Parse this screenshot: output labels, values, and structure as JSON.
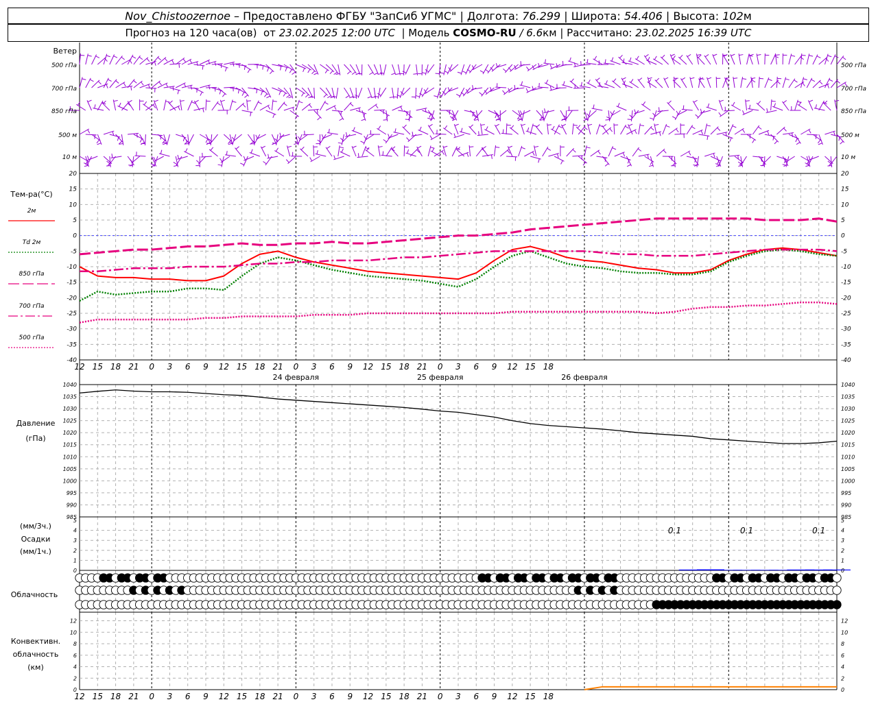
{
  "header": {
    "station": "Nov_Chistoozernoe",
    "provider": " – Предоставлено ФГБУ \"ЗапСиб УГМС\" | Долгота: ",
    "lon": "76.299",
    "lat_label": " | Широта: ",
    "lat": "54.406",
    "alt_label": " | Высота: ",
    "alt": "102",
    "alt_unit": "м",
    "forecast_label": "Прогноз на 120 часа(ов)  от ",
    "forecast_time": "23.02.2025 12:00 UTC",
    "model_label": "  | Модель ",
    "model": "COSMO-RU",
    "res": " / 6.6",
    "res_unit": "км",
    "calc_label": " | Рассчитано: ",
    "calc_time": "23.02.2025 16:39 UTC"
  },
  "wind": {
    "title": "Ветер",
    "levels": [
      "500 гПа",
      "700 гПа",
      "850 гПа",
      "500 м",
      "10 м"
    ]
  },
  "temp": {
    "title": "Тем-ра(°C)",
    "ticks": [
      20,
      15,
      10,
      5,
      0,
      -5,
      -10,
      -15,
      -20,
      -25,
      -30,
      -35,
      -40
    ],
    "legend": [
      {
        "label": "2м",
        "color": "#ff0000",
        "dash": "solid"
      },
      {
        "label": "Td  2м",
        "color": "#008000",
        "dash": "dot"
      },
      {
        "label": "850 гПа",
        "color": "#e6007e",
        "dash": "long"
      },
      {
        "label": "700 гПа",
        "color": "#e6007e",
        "dash": "dashdot"
      },
      {
        "label": "500 гПа",
        "color": "#e6007e",
        "dash": "dot"
      }
    ]
  },
  "time": {
    "hour_labels": [
      "12",
      "15",
      "18",
      "21",
      "0",
      "3",
      "6",
      "9",
      "12",
      "15",
      "18",
      "21",
      "0",
      "3",
      "6",
      "9",
      "12",
      "15",
      "18",
      "21",
      "0",
      "3",
      "6",
      "9",
      "12",
      "15",
      "18"
    ],
    "dates": [
      "24 февраля",
      "25 февраля",
      "26 февраля"
    ]
  },
  "pressure": {
    "title1": "Давление",
    "title2": "(гПа)",
    "ticks": [
      1040,
      1035,
      1030,
      1025,
      1020,
      1015,
      1010,
      1005,
      1000,
      995,
      990,
      985
    ]
  },
  "precip": {
    "title1": "(мм/3ч.)",
    "title2": "Осадки",
    "title3": "(мм/1ч.)",
    "ticks": [
      5,
      4,
      3,
      2,
      1,
      0
    ],
    "labels": [
      "0.1",
      "0.1",
      "0.1",
      "0.1",
      "0.1",
      "0.1"
    ]
  },
  "cloud": {
    "title": "Облачность"
  },
  "conv": {
    "title1": "Конвективн.",
    "title2": "облачность",
    "title3": "(км)",
    "ticks": [
      12,
      10,
      8,
      6,
      4,
      2,
      0
    ]
  },
  "chart_data": [
    {
      "type": "line",
      "title": "Тем-ра(°C)",
      "x": [
        0,
        3,
        6,
        9,
        12,
        15,
        18,
        21,
        24,
        27,
        30,
        33,
        36,
        39,
        42,
        45,
        48,
        51,
        54,
        57,
        60,
        63,
        66,
        69,
        72,
        75,
        78,
        81,
        84,
        87,
        90,
        93,
        96,
        99,
        102,
        105,
        108,
        111,
        114,
        117,
        120,
        123,
        126
      ],
      "ylim": [
        -40,
        20
      ],
      "series": [
        {
          "name": "2м",
          "color": "#ff0000",
          "values": [
            -10,
            -13,
            -13.5,
            -13.5,
            -14,
            -14,
            -14.5,
            -14.5,
            -13,
            -9,
            -6,
            -5,
            -7,
            -8.5,
            -9.5,
            -10.5,
            -11.5,
            -12,
            -12.5,
            -13,
            -13.5,
            -14,
            -12,
            -8,
            -4.5,
            -3.5,
            -5,
            -7,
            -8,
            -8.5,
            -9.5,
            -10.5,
            -11,
            -12,
            -12,
            -11,
            -8,
            -6,
            -4.5,
            -4,
            -4.5,
            -5.5,
            -6.5
          ]
        },
        {
          "name": "Td  2м",
          "color": "#008000",
          "values": [
            -21,
            -18,
            -19,
            -18.5,
            -18,
            -18,
            -17,
            -17,
            -17.5,
            -13,
            -9,
            -7,
            -8,
            -9.5,
            -11,
            -12,
            -13,
            -13.5,
            -14,
            -14.5,
            -15.5,
            -16.5,
            -14,
            -10,
            -6.5,
            -5,
            -7,
            -9,
            -10,
            -10.5,
            -11.5,
            -12,
            -12,
            -12.5,
            -12.5,
            -11.5,
            -8.5,
            -6.5,
            -5,
            -4.5,
            -5,
            -6,
            -6.5
          ]
        },
        {
          "name": "850 гПа",
          "color": "#e6007e",
          "values": [
            -6,
            -5.5,
            -5,
            -4.5,
            -4.5,
            -4,
            -3.5,
            -3.5,
            -3,
            -2.5,
            -3,
            -3,
            -2.5,
            -2.5,
            -2,
            -2.5,
            -2.5,
            -2,
            -1.5,
            -1,
            -0.5,
            0,
            0,
            0.5,
            1,
            2,
            2.5,
            3,
            3.5,
            4,
            4.5,
            5,
            5.5,
            5.5,
            5.5,
            5.5,
            5.5,
            5.5,
            5,
            5,
            5,
            5.5,
            4.5
          ]
        },
        {
          "name": "700 гПа",
          "color": "#e6007e",
          "values": [
            -11.5,
            -11.5,
            -11,
            -10.5,
            -10.5,
            -10.5,
            -10,
            -10,
            -10,
            -9.5,
            -9,
            -9,
            -8.5,
            -8.5,
            -8,
            -8,
            -8,
            -7.5,
            -7,
            -7,
            -6.5,
            -6,
            -5.5,
            -5,
            -5,
            -5,
            -5,
            -5,
            -5,
            -5.5,
            -6,
            -6,
            -6.5,
            -6.5,
            -6.5,
            -6,
            -5.5,
            -5,
            -4.5,
            -4.5,
            -4.5,
            -4.5,
            -5
          ]
        },
        {
          "name": "500 гПа",
          "color": "#e6007e",
          "values": [
            -28,
            -27,
            -27,
            -27,
            -27,
            -27,
            -27,
            -26.5,
            -26.5,
            -26,
            -26,
            -26,
            -26,
            -25.5,
            -25.5,
            -25.5,
            -25,
            -25,
            -25,
            -25,
            -25,
            -25,
            -25,
            -25,
            -24.5,
            -24.5,
            -24.5,
            -24.5,
            -24.5,
            -24.5,
            -24.5,
            -24.5,
            -25,
            -24.5,
            -23.5,
            -23,
            -23,
            -22.5,
            -22.5,
            -22,
            -21.5,
            -21.5,
            -22
          ]
        }
      ]
    },
    {
      "type": "line",
      "title": "Давление",
      "ylabel": "(гПа)",
      "x": [
        0,
        3,
        6,
        9,
        12,
        15,
        18,
        21,
        24,
        27,
        30,
        33,
        36,
        39,
        42,
        45,
        48,
        51,
        54,
        57,
        60,
        63,
        66,
        69,
        72,
        75,
        78,
        81,
        84,
        87,
        90,
        93,
        96,
        99,
        102,
        105,
        108,
        111,
        114,
        117,
        120,
        123,
        126
      ],
      "ylim": [
        985,
        1040
      ],
      "series": [
        {
          "name": "",
          "color": "#000000",
          "values": [
            1036.5,
            1037.2,
            1037.8,
            1037.3,
            1037,
            1037,
            1036.8,
            1036.3,
            1035.8,
            1035.5,
            1034.8,
            1034,
            1033.5,
            1033,
            1032.5,
            1032,
            1031.5,
            1031,
            1030.5,
            1029.8,
            1029,
            1028.5,
            1027.5,
            1026.5,
            1025,
            1023.8,
            1023,
            1022.5,
            1022,
            1021.5,
            1020.8,
            1020,
            1019.5,
            1019,
            1018.5,
            1017.5,
            1017,
            1016.5,
            1016,
            1015.5,
            1015.5,
            1015.8,
            1016.5
          ]
        }
      ]
    },
    {
      "type": "bar",
      "title": "Осадки",
      "x": [
        87,
        90,
        93,
        96,
        99,
        102,
        105,
        108,
        111,
        114,
        117,
        120,
        123,
        126
      ],
      "ylim": [
        0,
        5
      ],
      "values": [
        0,
        0,
        0,
        0,
        0,
        0.08,
        0.1,
        0.05,
        0.05,
        0.05,
        0.05,
        0.08,
        0.08,
        0.08
      ],
      "labels": [
        "0.1",
        "0.1",
        "0.1",
        "0.1",
        "0.1",
        "0.1"
      ]
    },
    {
      "type": "line",
      "title": "Конвективн. облачность",
      "ylabel": "(км)",
      "x": [
        84,
        87,
        90,
        93,
        96,
        99,
        102,
        105,
        108,
        111,
        114,
        117,
        120,
        123,
        126
      ],
      "ylim": [
        0,
        12
      ],
      "series": [
        {
          "name": "",
          "color": "#ff8000",
          "values": [
            0,
            0.5,
            0.5,
            0.5,
            0.5,
            0.5,
            0.5,
            0.5,
            0.5,
            0.5,
            0.5,
            0.5,
            0.5,
            0.5,
            0.5
          ]
        }
      ]
    }
  ]
}
